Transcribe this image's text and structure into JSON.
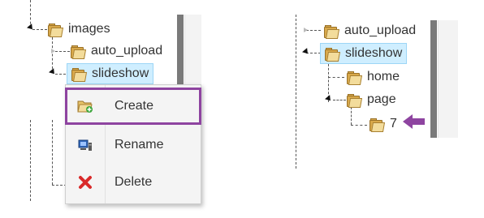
{
  "left_tree": {
    "items": [
      {
        "label": "images"
      },
      {
        "label": "auto_upload"
      },
      {
        "label": "slideshow"
      }
    ]
  },
  "context_menu": {
    "items": [
      {
        "label": "Create",
        "icon": "folder-add-icon"
      },
      {
        "label": "Rename",
        "icon": "rename-icon"
      },
      {
        "label": "Delete",
        "icon": "delete-icon"
      }
    ]
  },
  "right_tree": {
    "items": [
      {
        "label": "auto_upload"
      },
      {
        "label": "slideshow"
      },
      {
        "label": "home"
      },
      {
        "label": "page"
      },
      {
        "label": "7"
      }
    ]
  },
  "colors": {
    "highlight_outline": "#8e44a0",
    "selected_bg": "#cfeeff",
    "folder": "#d8a84a"
  }
}
